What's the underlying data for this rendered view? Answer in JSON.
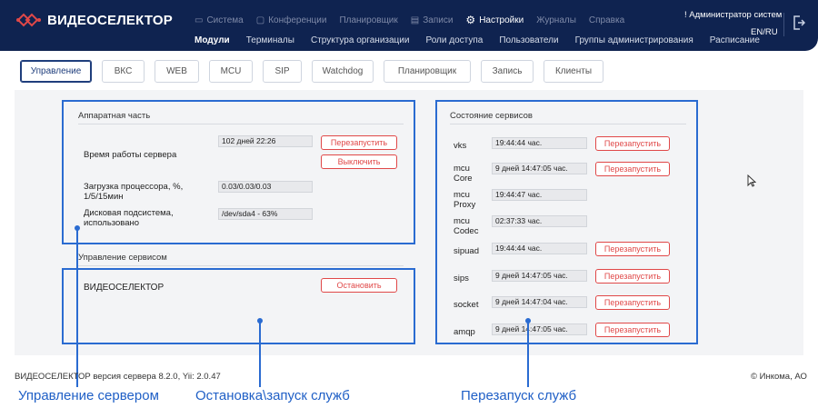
{
  "app": {
    "name": "ВИДЕОСЕЛЕКТОР",
    "brand_color": "#0f2350",
    "accent_color": "#e04848"
  },
  "top_nav": [
    {
      "label": "Система",
      "icon": "monitor-icon",
      "active": false
    },
    {
      "label": "Конференции",
      "icon": "chat-icon",
      "active": false
    },
    {
      "label": "Планировщик",
      "icon": "",
      "active": false
    },
    {
      "label": "Записи",
      "icon": "film-icon",
      "active": false
    },
    {
      "label": "Настройки",
      "icon": "gears-icon",
      "active": true
    },
    {
      "label": "Журналы",
      "icon": "",
      "active": false
    },
    {
      "label": "Справка",
      "icon": "",
      "active": false
    }
  ],
  "sub_nav": [
    "Модули",
    "Терминалы",
    "Структура организации",
    "Роли доступа",
    "Пользователи",
    "Группы администрирования",
    "Расписание"
  ],
  "admin_label": "! Администратор систем",
  "lang_label": "EN/RU",
  "tabs": [
    "Управление",
    "ВКС",
    "WEB",
    "MCU",
    "SIP",
    "Watchdog",
    "Планировщик",
    "Запись",
    "Клиенты"
  ],
  "hardware": {
    "title": "Аппаратная часть",
    "uptime_label": "Время работы сервера",
    "uptime_value": "102 дней 22:26",
    "cpu_label": "Загрузка процессора, %, 1/5/15мин",
    "cpu_value": "0.03/0.03/0.03",
    "disk_label": "Дисковая подсистема, использовано",
    "disk_value": "/dev/sda4 - 63%",
    "restart_button": "Перезапустить",
    "shutdown_button": "Выключить"
  },
  "service_control": {
    "title": "Управление сервисом",
    "name": "ВИДЕОСЕЛЕКТОР",
    "stop_button": "Остановить"
  },
  "services": {
    "title": "Состояние сервисов",
    "restart_label": "Перезапустить",
    "items": [
      {
        "name": "vks",
        "uptime": "19:44:44 час.",
        "restartable": true
      },
      {
        "name": "mcu Core",
        "uptime": "9 дней 14:47:05 час.",
        "restartable": true
      },
      {
        "name": "mcu Proxy",
        "uptime": "19:44:47 час.",
        "restartable": false
      },
      {
        "name": "mcu Codec",
        "uptime": "02:37:33 час.",
        "restartable": false
      },
      {
        "name": "sipuad",
        "uptime": "19:44:44 час.",
        "restartable": true
      },
      {
        "name": "sips",
        "uptime": "9 дней 14:47:05 час.",
        "restartable": true
      },
      {
        "name": "socket",
        "uptime": "9 дней 14:47:04 час.",
        "restartable": true
      },
      {
        "name": "amqp",
        "uptime": "9 дней 14:47:05 час.",
        "restartable": true
      }
    ]
  },
  "annotations": {
    "server_control": "Управление сервером",
    "stop_start": "Остановка\\запуск служб",
    "restart_services": "Перезапуск служб"
  },
  "footer": {
    "version": "ВИДЕОСЕЛЕКТОР версия сервера 8.2.0, Yii: 2.0.47",
    "copyright": "© Инкома, АО"
  }
}
